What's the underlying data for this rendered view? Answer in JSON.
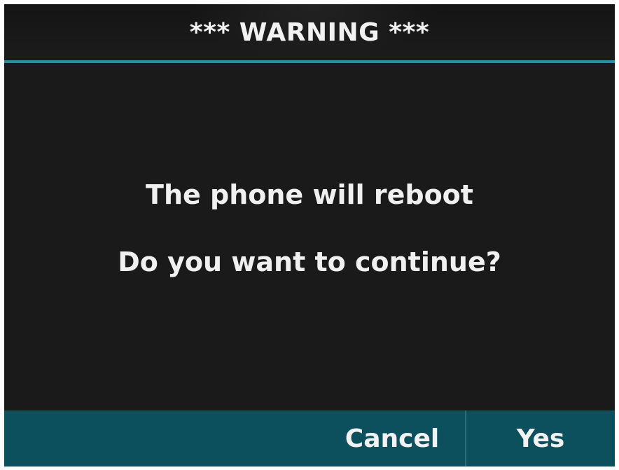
{
  "dialog": {
    "title": "*** WARNING ***",
    "message_line_1": "The phone will reboot",
    "message_line_2": "Do you want to continue?"
  },
  "softkeys": {
    "cancel_label": "Cancel",
    "yes_label": "Yes"
  },
  "colors": {
    "background": "#1a1a1a",
    "accent_line": "#1d93a8",
    "softkey_bar": "#0b505c",
    "text": "#f0f0f0"
  }
}
